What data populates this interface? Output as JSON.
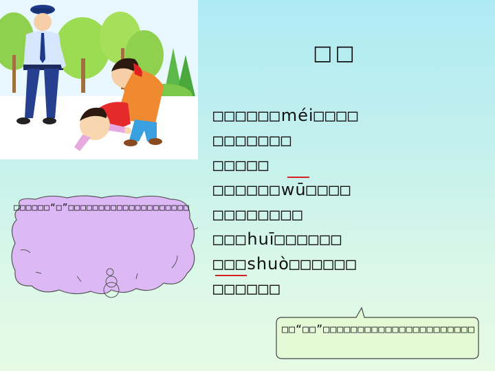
{
  "title": "□□",
  "poem": {
    "lines": [
      "□□□□□□méi□□□□",
      "□□□□□□□",
      "□□□□□",
      "□□□□□□wū□□□□",
      "□□□□□□□□",
      "□□□huī□□□□□□",
      "□□□shuò□□□□□□",
      "□□□□□□"
    ]
  },
  "thought_bubble": {
    "text": "□□□□□□“□”□□□□□□□□□□□□□□□□□□□□"
  },
  "callout": {
    "text": "□□“□□”□□□□□□□□□□□□□□□□□□□□□□"
  },
  "colors": {
    "underline": "#d42020",
    "thought_fill": "#dcb8f4",
    "callout_fill": "#e4fad6"
  },
  "illustration": {
    "icon": "police-officer-and-children-illustration"
  }
}
